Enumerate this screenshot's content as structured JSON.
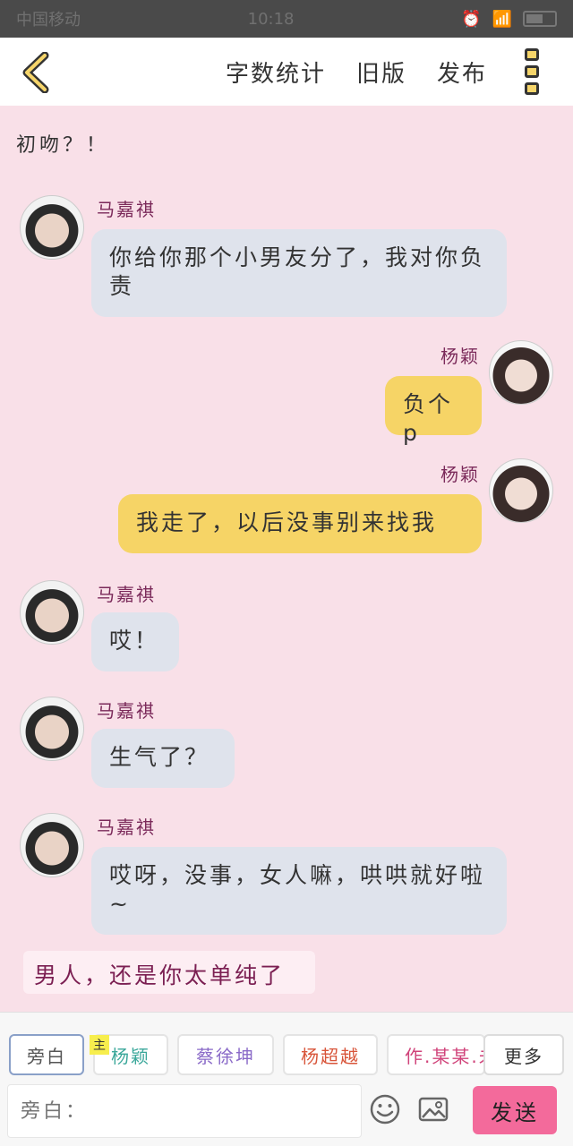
{
  "status_bar": {
    "carrier": "中国移动",
    "time": "10:18",
    "battery": ""
  },
  "header": {
    "actions": [
      "字数统计",
      "旧版",
      "发布"
    ]
  },
  "chat": {
    "opening_narration": "初吻？！",
    "messages": [
      {
        "speaker": "马嘉祺",
        "side": "left",
        "text": "你给你那个小男友分了，我对你负责"
      },
      {
        "speaker": "杨颖",
        "side": "right",
        "text": "负个p"
      },
      {
        "speaker": "杨颖",
        "side": "right",
        "text": "我走了，以后没事别来找我"
      },
      {
        "speaker": "马嘉祺",
        "side": "left",
        "text": "哎！"
      },
      {
        "speaker": "马嘉祺",
        "side": "left",
        "text": "生气了？"
      },
      {
        "speaker": "马嘉祺",
        "side": "left",
        "text": "哎呀，没事，女人嘛，哄哄就好啦~"
      }
    ],
    "closing_narration": "男人，还是你太单纯了"
  },
  "bottom": {
    "roles": [
      "旁白",
      "杨颖",
      "蔡徐坤",
      "杨超越",
      "作.某某.未"
    ],
    "host_badge": "主",
    "more_label": "更多",
    "input_placeholder": "旁白：",
    "send_label": "发送"
  },
  "colors": {
    "background": "#f9e0e8",
    "left_bubble": "#dfe3ec",
    "right_bubble": "#f6d466",
    "send_button": "#f36a9b",
    "speaker_name": "#7b2a5a",
    "role_yangying": "#3aa79a",
    "role_caixukun": "#8a6ac8",
    "role_yangchaoyue": "#d8553a",
    "role_author": "#d0437a"
  }
}
